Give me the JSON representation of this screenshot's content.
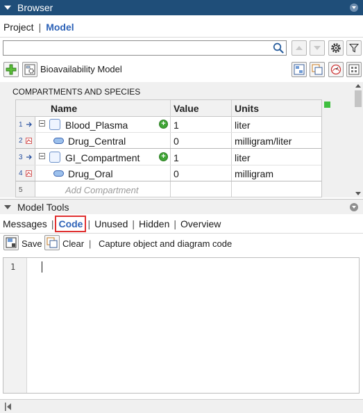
{
  "browser": {
    "title": "Browser",
    "nav": {
      "project_label": "Project",
      "separator": "|",
      "model_label": "Model"
    },
    "search": {
      "value": "",
      "placeholder": ""
    }
  },
  "model_toolbar": {
    "model_name": "Bioavailability Model"
  },
  "compartments": {
    "heading": "COMPARTMENTS AND SPECIES",
    "columns": {
      "name": "Name",
      "value": "Value",
      "units": "Units"
    },
    "rows": [
      {
        "num": "1",
        "name": "Blood_Plasma",
        "value": "1",
        "units": "liter",
        "kind": "compartment"
      },
      {
        "num": "2",
        "name": "Drug_Central",
        "value": "0",
        "units": "milligram/liter",
        "kind": "species"
      },
      {
        "num": "3",
        "name": "GI_Compartment",
        "value": "1",
        "units": "liter",
        "kind": "compartment"
      },
      {
        "num": "4",
        "name": "Drug_Oral",
        "value": "0",
        "units": "milligram",
        "kind": "species"
      },
      {
        "num": "5",
        "name": "Add Compartment",
        "value": "",
        "units": "",
        "kind": "placeholder"
      }
    ]
  },
  "model_tools": {
    "title": "Model Tools",
    "tabs": [
      "Messages",
      "Code",
      "Unused",
      "Hidden",
      "Overview"
    ],
    "active_tab": "Code",
    "separator": "|",
    "toolbar": {
      "save_label": "Save",
      "clear_label": "Clear",
      "separator": "|",
      "description": "Capture object and diagram code"
    },
    "editor": {
      "line_numbers": [
        "1"
      ],
      "content": ""
    }
  },
  "colors": {
    "titlebar": "#1f4e79",
    "active_link": "#2e63b8",
    "highlight_box": "#e03030",
    "add_green": "#3fa535"
  }
}
